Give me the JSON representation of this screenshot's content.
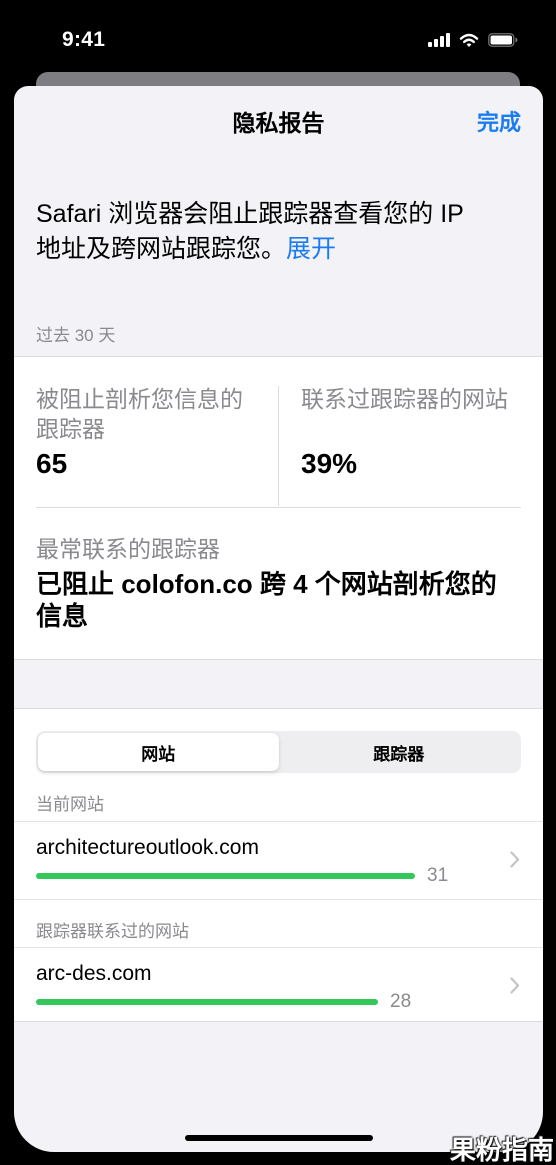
{
  "status_bar": {
    "time": "9:41"
  },
  "header": {
    "title": "隐私报告",
    "done_label": "完成"
  },
  "intro": {
    "lines": [
      "Safari 浏览器会阻止跟踪器查看您的 IP",
      "地址及跨网站跟踪您。"
    ],
    "expand_label": "展开"
  },
  "period_label": "过去 30 天",
  "stats": {
    "blocked": {
      "label_lines": [
        "被阻止剖析您信息的",
        "跟踪器"
      ],
      "value": "65"
    },
    "sites": {
      "label": "联系过跟踪器的网站",
      "value": "39%"
    }
  },
  "top_tracker": {
    "label": "最常联系的跟踪器",
    "lines": [
      "已阻止 colofon.co 跨 4 个网站剖析您的",
      "信息"
    ]
  },
  "segmented": {
    "options": [
      "网站",
      "跟踪器"
    ],
    "selected": 0
  },
  "current_site": {
    "header": "当前网站",
    "items": [
      {
        "domain": "architectureoutlook.com",
        "count": 31
      }
    ]
  },
  "contacted_sites": {
    "header": "跟踪器联系过的网站",
    "items": [
      {
        "domain": "arc-des.com",
        "count": 28
      }
    ]
  },
  "colors": {
    "accent": "#1a7cf0",
    "bar": "#34c759"
  },
  "icons": [
    "cellular-signal-icon",
    "wifi-icon",
    "battery-icon",
    "chevron-right-icon"
  ],
  "watermark": "果粉指南"
}
